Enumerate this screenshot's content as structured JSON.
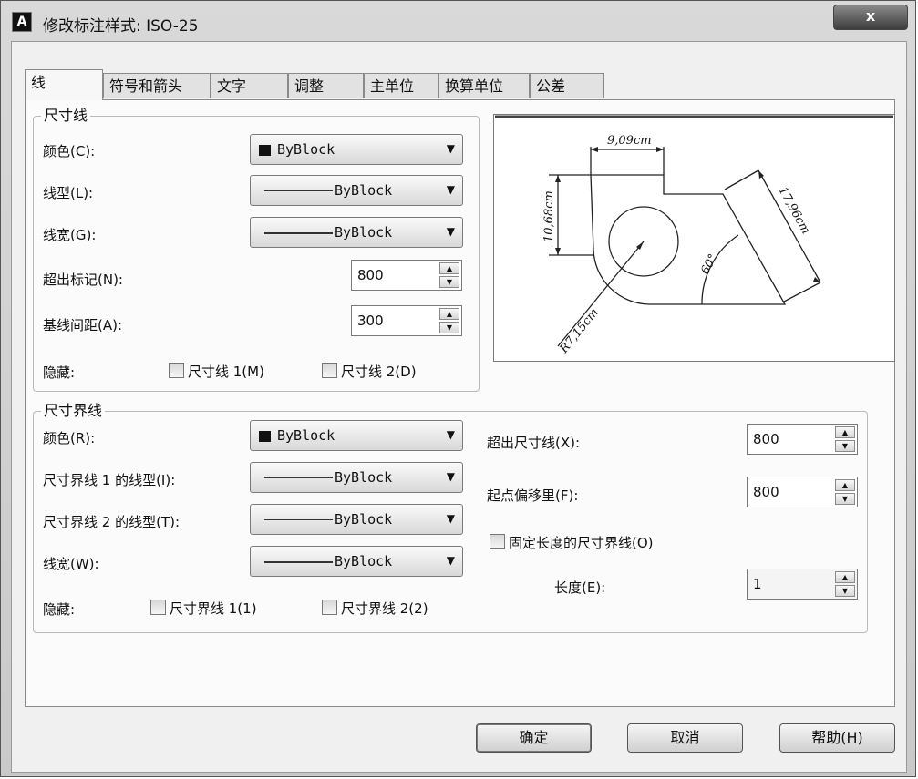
{
  "window": {
    "icon_letter": "A",
    "title": "修改标注样式: ISO-25",
    "close": "x"
  },
  "tabs": [
    "线",
    "符号和箭头",
    "文字",
    "调整",
    "主单位",
    "换算单位",
    "公差"
  ],
  "dim_line": {
    "legend": "尺寸线",
    "color_label": "颜色(C):",
    "color_value": "ByBlock",
    "linetype_label": "线型(L):",
    "linetype_value": "ByBlock",
    "lineweight_label": "线宽(G):",
    "lineweight_value": "ByBlock",
    "extend_label": "超出标记(N):",
    "extend_value": "800",
    "baseline_label": "基线间距(A):",
    "baseline_value": "300",
    "suppress_label": "隐藏:",
    "suppress1": "尺寸线 1(M)",
    "suppress2": "尺寸线 2(D)"
  },
  "preview": {
    "top_dim": "9,09cm",
    "left_dim": "10,68cm",
    "slant_dim": "17,96cm",
    "angle_dim": "60°",
    "radius_dim": "R7,15cm"
  },
  "ext_line": {
    "legend": "尺寸界线",
    "color_label": "颜色(R):",
    "color_value": "ByBlock",
    "linetype1_label": "尺寸界线 1 的线型(I):",
    "linetype1_value": "ByBlock",
    "linetype2_label": "尺寸界线 2 的线型(T):",
    "linetype2_value": "ByBlock",
    "lineweight_label": "线宽(W):",
    "lineweight_value": "ByBlock",
    "suppress_label": "隐藏:",
    "suppress1": "尺寸界线 1(1)",
    "suppress2": "尺寸界线 2(2)",
    "extend_label": "超出尺寸线(X):",
    "extend_value": "800",
    "offset_label": "起点偏移里(F):",
    "offset_value": "800",
    "fixed_label": "固定长度的尺寸界线(O)",
    "length_label": "长度(E):",
    "length_value": "1"
  },
  "buttons": {
    "ok": "确定",
    "cancel": "取消",
    "help": "帮助(H)"
  }
}
